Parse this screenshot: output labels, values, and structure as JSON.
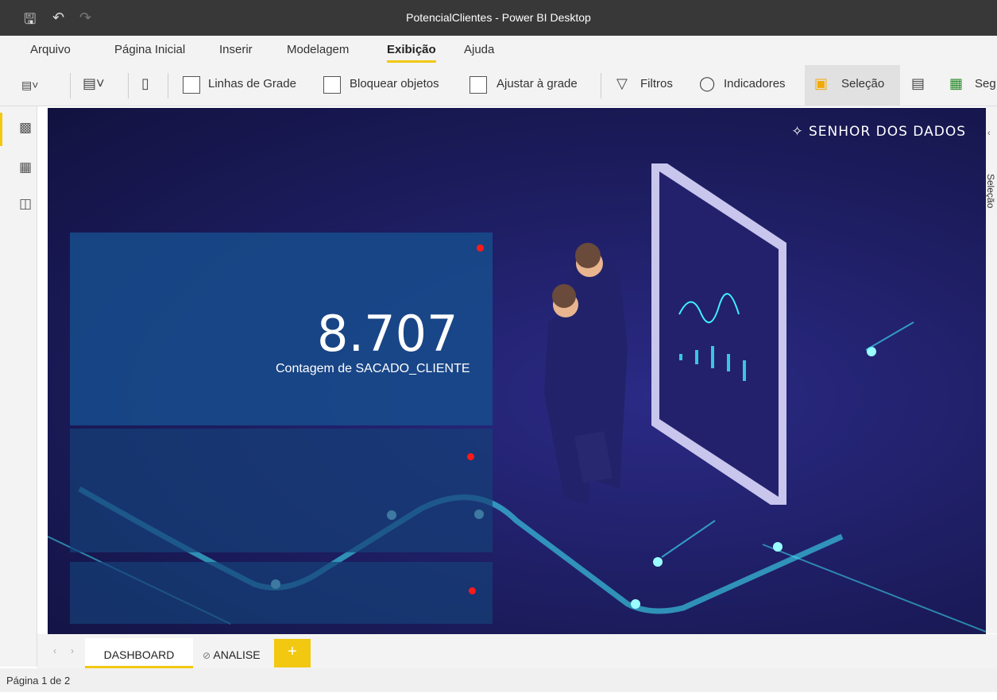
{
  "app": {
    "title": "PotencialClientes - Power BI Desktop"
  },
  "menu": [
    "Arquivo",
    "Página Inicial",
    "Inserir",
    "Modelagem",
    "Exibição",
    "Ajuda"
  ],
  "menu_active": "Exibição",
  "ribbon": {
    "gridlines": "Linhas de Grade",
    "lock": "Bloquear objetos",
    "snap": "Ajustar à grade",
    "filters": "Filtros",
    "bookmarks": "Indicadores",
    "selection": "Seleção",
    "sync": "Seg"
  },
  "canvas": {
    "logo": "SENHOR DOS DADOS",
    "kpi_value": "8.707",
    "kpi_label": "Contagem de SACADO_CLIENTE"
  },
  "sidepane_label": "Seleção",
  "tabs": [
    "DASHBOARD",
    "ANALISE"
  ],
  "add_tab": "+",
  "status": "Página 1 de 2",
  "colors": {
    "accent": "#f2c811",
    "canvas": "#1c1c5e",
    "card": "#184c8c",
    "glow": "#3ff0ff"
  },
  "icons": [
    "save-icon",
    "undo-icon",
    "redo-icon",
    "theme-icon",
    "page-view-icon",
    "mobile-layout-icon",
    "filter-icon",
    "bookmark-icon",
    "selection-icon",
    "performance-icon",
    "sync-icon",
    "report-view-icon",
    "data-view-icon",
    "model-view-icon",
    "eye-hidden-icon",
    "senhor-dos-dados-logo"
  ]
}
